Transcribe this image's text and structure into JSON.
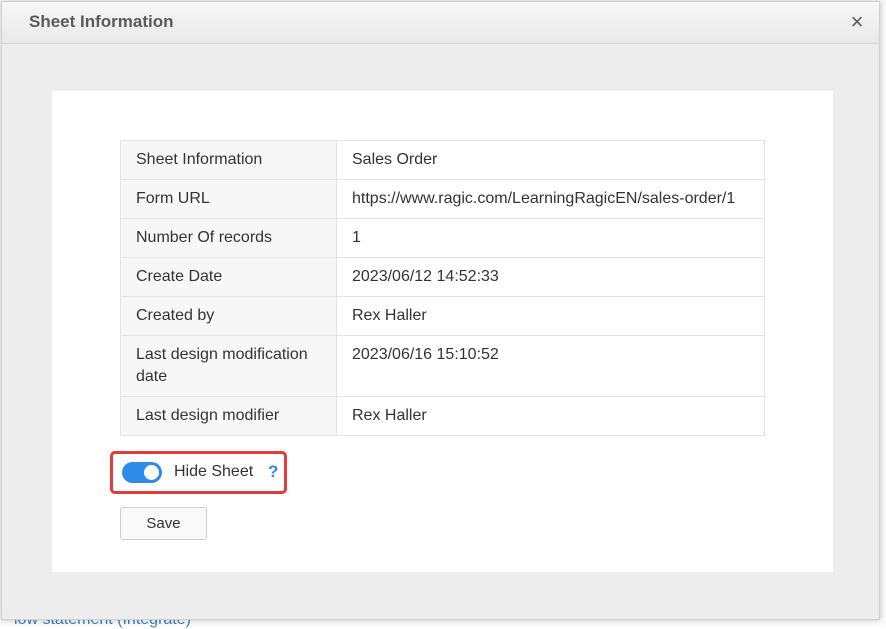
{
  "dialog": {
    "title": "Sheet Information",
    "close_glyph": "×"
  },
  "info": {
    "rows": [
      {
        "label": "Sheet Information",
        "value": "Sales Order"
      },
      {
        "label": "Form URL",
        "value": "https://www.ragic.com/LearningRagicEN/sales-order/1"
      },
      {
        "label": "Number Of records",
        "value": "1"
      },
      {
        "label": "Create Date",
        "value": "2023/06/12 14:52:33"
      },
      {
        "label": "Created by",
        "value": "Rex Haller"
      },
      {
        "label": "Last design modification date",
        "value": "2023/06/16 15:10:52"
      },
      {
        "label": "Last design modifier",
        "value": "Rex Haller"
      }
    ]
  },
  "hide_sheet": {
    "label": "Hide Sheet",
    "enabled": true,
    "help_glyph": "?"
  },
  "save_label": "Save",
  "background": {
    "bottom_text": "low statement (Integrate)"
  },
  "colors": {
    "toggle_on": "#2f8be8",
    "highlight_border": "#e5393c",
    "help": "#2f8be8"
  },
  "icons": {
    "close": "close-icon",
    "help": "question-icon"
  }
}
